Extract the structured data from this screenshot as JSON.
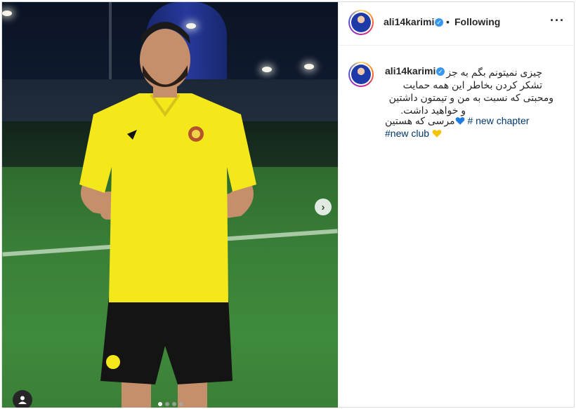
{
  "post": {
    "username": "ali14karimi",
    "verified_mark": "✓",
    "separator": "•",
    "follow_status": "Following",
    "more_glyph": "···"
  },
  "caption": {
    "line1": "چیزی نمیتونم بگم به جز",
    "line2": "تشکر کردن بخاطر این همه حمایت",
    "line3": "ومحبتی که نسبت به من و تیمتون داشتین",
    "line4": "و خواهید داشت.",
    "line5_persian": "مرسی که هستین",
    "line5_hashtag": "# new chapter",
    "line6_hashtag": "#new club"
  },
  "carousel": {
    "next_glyph": "›",
    "slide_count": 4,
    "active_index": 0
  },
  "icons": {
    "verified": "verified-badge-icon",
    "blue_heart": "blue-heart-icon",
    "yellow_heart": "yellow-heart-icon",
    "next": "chevron-right-icon",
    "user_tag": "user-tag-icon"
  },
  "colors": {
    "jersey_yellow": "#f4e81a",
    "verified_blue": "#3897f0",
    "heart_blue": "#1f7be0",
    "heart_yellow": "#f2c500",
    "hashtag": "#00376b"
  }
}
